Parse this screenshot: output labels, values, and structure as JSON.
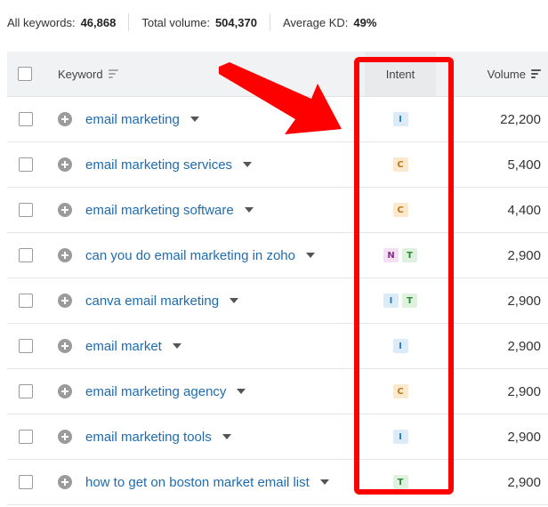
{
  "summary": {
    "all_keywords_label": "All keywords:",
    "all_keywords_value": "46,868",
    "total_volume_label": "Total volume:",
    "total_volume_value": "504,370",
    "avg_kd_label": "Average KD:",
    "avg_kd_value": "49%"
  },
  "table": {
    "headers": {
      "keyword": "Keyword",
      "intent": "Intent",
      "volume": "Volume"
    },
    "rows": [
      {
        "keyword": "email marketing",
        "intents": [
          "I"
        ],
        "volume": "22,200"
      },
      {
        "keyword": "email marketing services",
        "intents": [
          "C"
        ],
        "volume": "5,400"
      },
      {
        "keyword": "email marketing software",
        "intents": [
          "C"
        ],
        "volume": "4,400"
      },
      {
        "keyword": "can you do email marketing in zoho",
        "intents": [
          "N",
          "T"
        ],
        "volume": "2,900"
      },
      {
        "keyword": "canva email marketing",
        "intents": [
          "I",
          "T"
        ],
        "volume": "2,900"
      },
      {
        "keyword": "email market",
        "intents": [
          "I"
        ],
        "volume": "2,900"
      },
      {
        "keyword": "email marketing agency",
        "intents": [
          "C"
        ],
        "volume": "2,900"
      },
      {
        "keyword": "email marketing tools",
        "intents": [
          "I"
        ],
        "volume": "2,900"
      },
      {
        "keyword": "how to get on boston market email list",
        "intents": [
          "T"
        ],
        "volume": "2,900"
      }
    ]
  },
  "colors": {
    "link": "#1f6bb0",
    "annotation": "#ff0000",
    "header_bg": "#f1f2f4",
    "intent_I": "#2a78c3",
    "intent_C": "#c17a1a",
    "intent_N": "#8a2c8f",
    "intent_T": "#2f8a36"
  }
}
